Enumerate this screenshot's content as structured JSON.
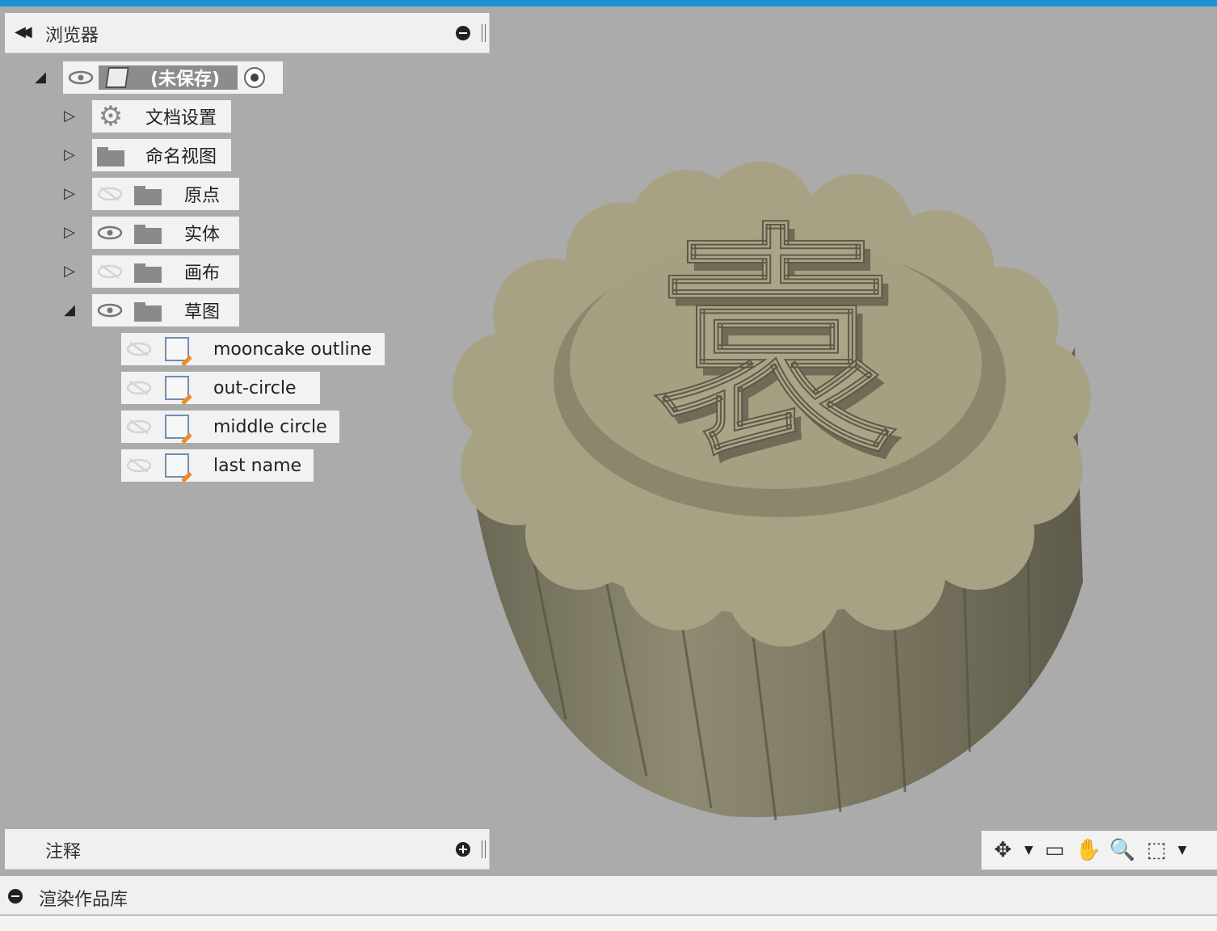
{
  "browser": {
    "title": "浏览器",
    "root": {
      "label": "(未保存)"
    },
    "nodes": [
      {
        "label": "文档设置",
        "icon": "gear-icon"
      },
      {
        "label": "命名视图",
        "icon": "folder-icon"
      },
      {
        "label": "原点",
        "icon": "folder-icon",
        "visible": false
      },
      {
        "label": "实体",
        "icon": "folder-icon",
        "visible": true
      },
      {
        "label": "画布",
        "icon": "folder-icon",
        "visible": false
      },
      {
        "label": "草图",
        "icon": "folder-icon",
        "visible": true,
        "expanded": true
      }
    ],
    "sketches": [
      {
        "label": "mooncake outline",
        "visible": false
      },
      {
        "label": "out-circle",
        "visible": false
      },
      {
        "label": "middle circle",
        "visible": false
      },
      {
        "label": "last name",
        "visible": false
      }
    ]
  },
  "notes": {
    "title": "注释"
  },
  "bottom": {
    "title": "渲染作品库"
  },
  "model": {
    "character": "袁",
    "color": "#a8a285"
  },
  "colors": {
    "accent": "#1f8fd8",
    "canvas": "#ababab",
    "panel": "#f0f0f0"
  }
}
